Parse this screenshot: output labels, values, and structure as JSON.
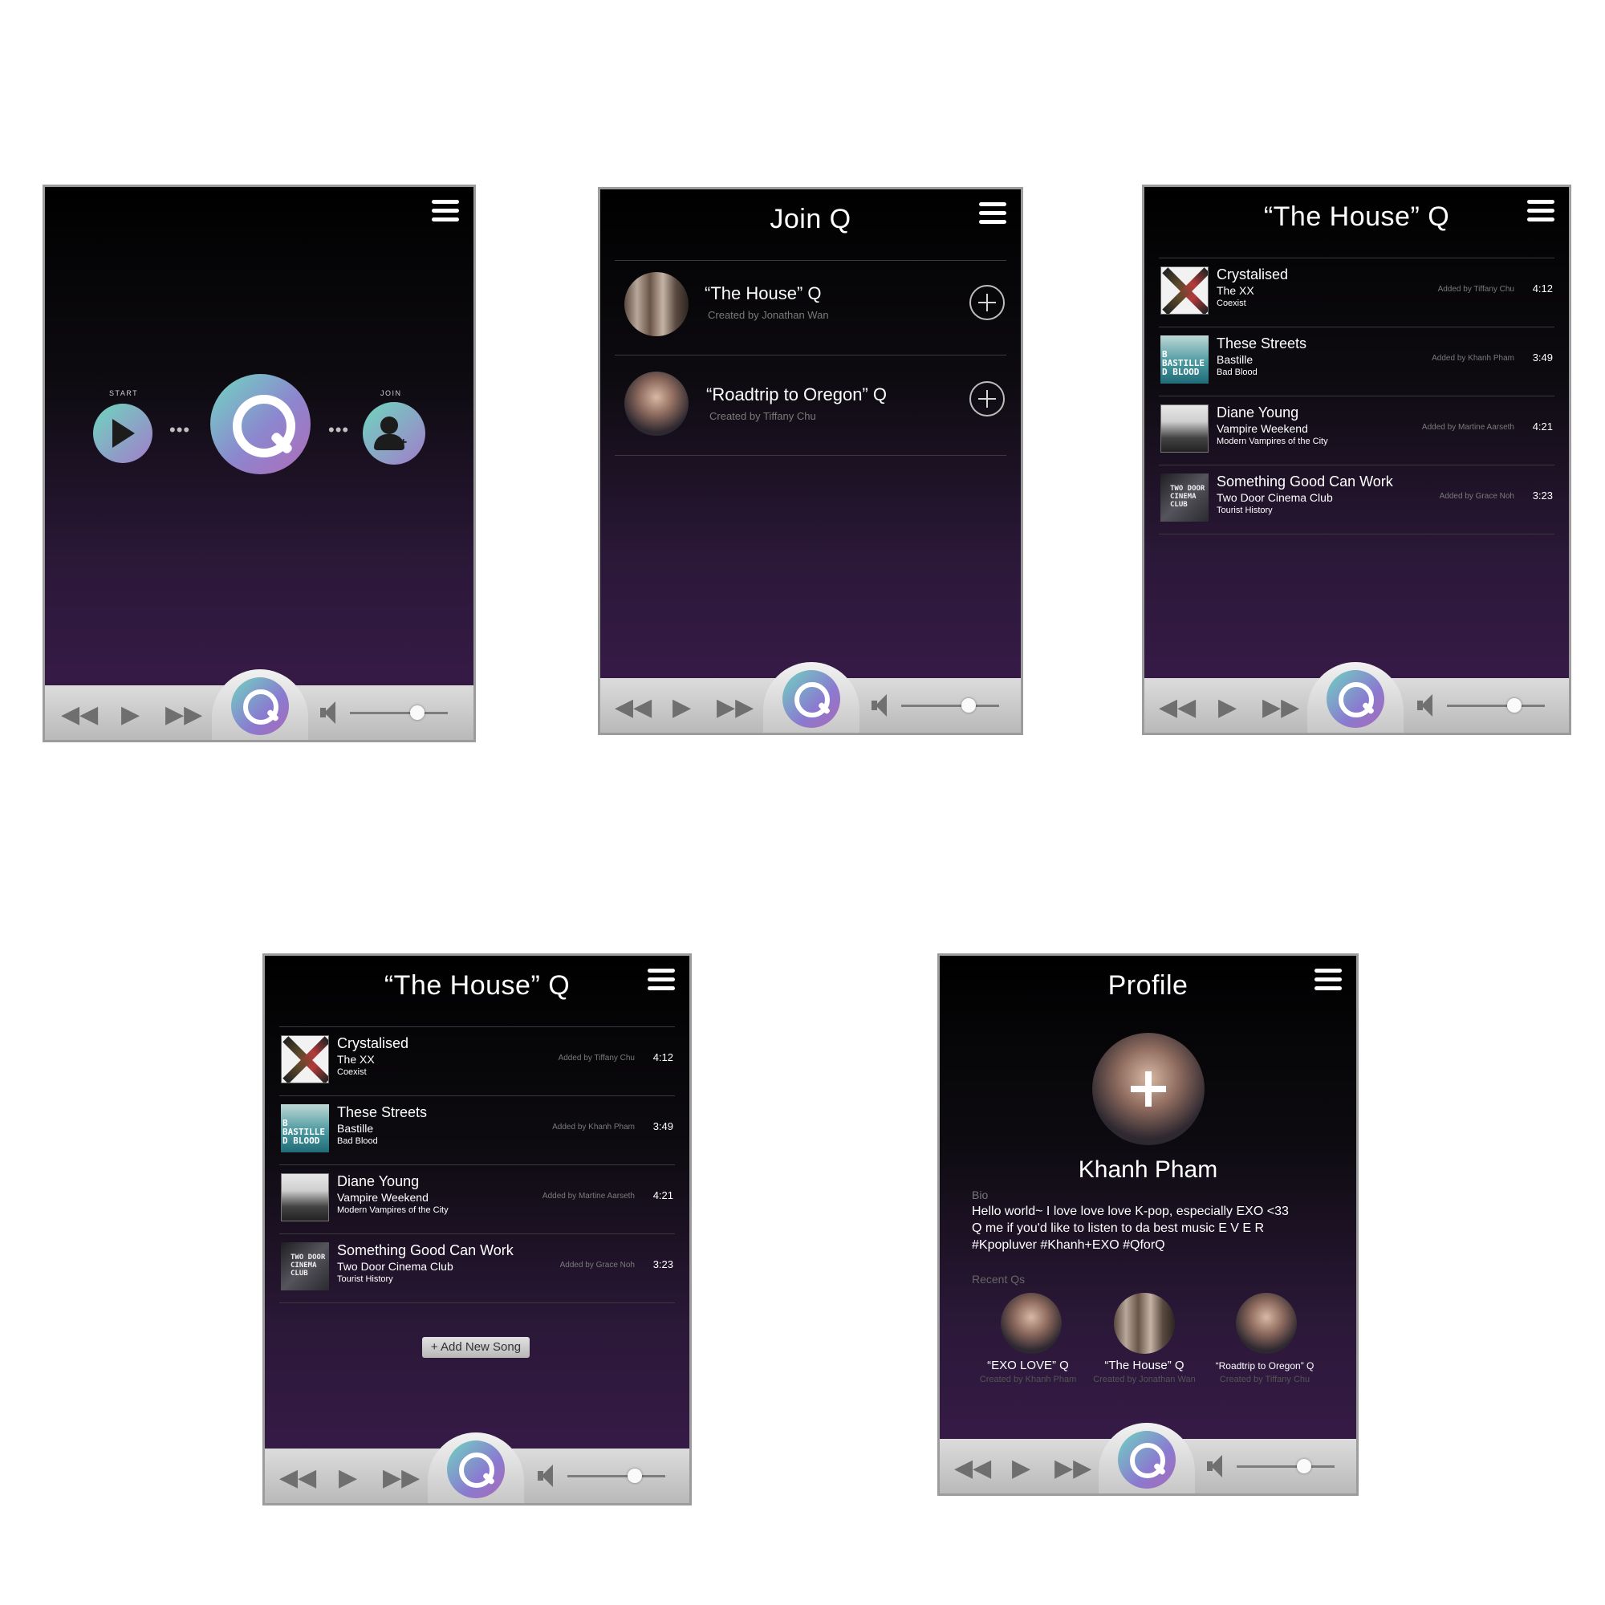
{
  "colors": {
    "accent_teal": "#6fd7c2",
    "accent_purple": "#b06bb7",
    "bg_top": "#000000",
    "bg_bottom": "#3a1b4c",
    "player_gray": "#c7c7c7"
  },
  "player": {
    "rewind_icon": "rewind-icon",
    "play_icon": "play-icon",
    "forward_icon": "fast-forward-icon",
    "volume_icon": "volume-icon",
    "volume_level": 0.7
  },
  "home": {
    "start_label": "START",
    "join_label": "JOIN",
    "dots": "•••"
  },
  "join": {
    "title": "Join Q",
    "queues": [
      {
        "name": "“The House” Q",
        "creator": "Created by Jonathan Wan"
      },
      {
        "name": "“Roadtrip to Oregon” Q",
        "creator": "Created by Tiffany Chu"
      }
    ]
  },
  "house": {
    "title": "“The House” Q",
    "songs": [
      {
        "title": "Crystalised",
        "artist": "The XX",
        "album": "Coexist",
        "added_by": "Added by Tiffany Chu",
        "duration": "4:12"
      },
      {
        "title": "These Streets",
        "artist": "Bastille",
        "album": "Bad Blood",
        "added_by": "Added by Khanh Pham",
        "duration": "3:49"
      },
      {
        "title": "Diane Young",
        "artist": "Vampire Weekend",
        "album": "Modern Vampires of the City",
        "added_by": "Added by Martine Aarseth",
        "duration": "4:21"
      },
      {
        "title": "Something Good Can Work",
        "artist": "Two Door Cinema Club",
        "album": "Tourist History",
        "added_by": "Added by Grace Noh",
        "duration": "3:23"
      }
    ],
    "add_button": "+ Add New Song"
  },
  "album_art": {
    "bastille": "B BASTILLE D BLOOD",
    "tdcc": "TWO DOOR CINEMA CLUB"
  },
  "profile": {
    "title": "Profile",
    "name": "Khanh Pham",
    "bio_label": "Bio",
    "bio_lines": [
      "Hello world~ I love love love K-pop, especially EXO <33",
      "Q me if you'd like to listen to da best music E V E R",
      "#Kpopluver #Khanh+EXO #QforQ"
    ],
    "recent_label": "Recent Qs",
    "recent": [
      {
        "name": "“EXO LOVE” Q",
        "creator": "Created by Khanh Pham"
      },
      {
        "name": "“The House” Q",
        "creator": "Created by Jonathan Wan"
      },
      {
        "name": "“Roadtrip to Oregon” Q",
        "creator": "Created by Tiffany Chu"
      }
    ]
  }
}
